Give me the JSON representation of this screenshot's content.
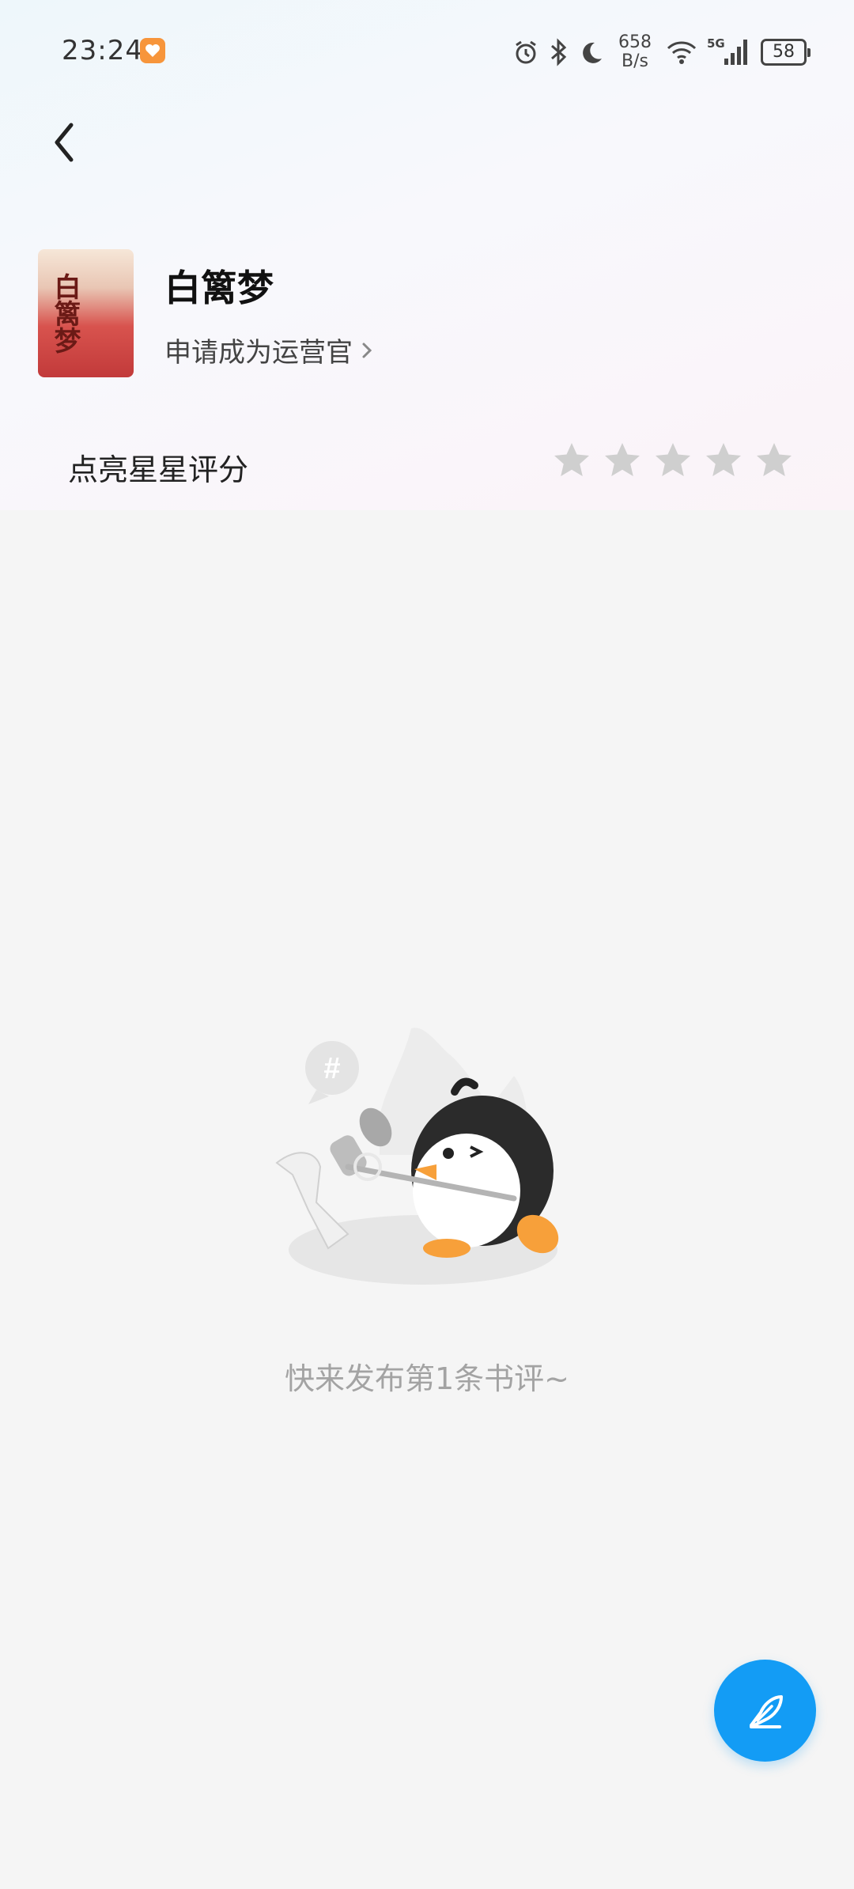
{
  "status_bar": {
    "time": "23:24",
    "net_speed_value": "658",
    "net_speed_unit": "B/s",
    "network_type": "5G",
    "battery": "58",
    "icons": [
      "alarm-icon",
      "bluetooth-icon",
      "moon-icon",
      "wifi-icon",
      "signal-icon",
      "battery-icon"
    ]
  },
  "book": {
    "title": "白篱梦",
    "cover_text": "白篱梦",
    "apply_link": "申请成为运营官"
  },
  "rating": {
    "label": "点亮星星评分",
    "stars_total": 5,
    "stars_filled": 0
  },
  "empty_state": {
    "message": "快来发布第1条书评~"
  },
  "fab": {
    "icon": "feather-pen-icon"
  },
  "colors": {
    "accent": "#139cf5",
    "star_inactive": "#cfcfcf",
    "empty_text": "#a3a3a3",
    "badge": "#f7953b"
  }
}
